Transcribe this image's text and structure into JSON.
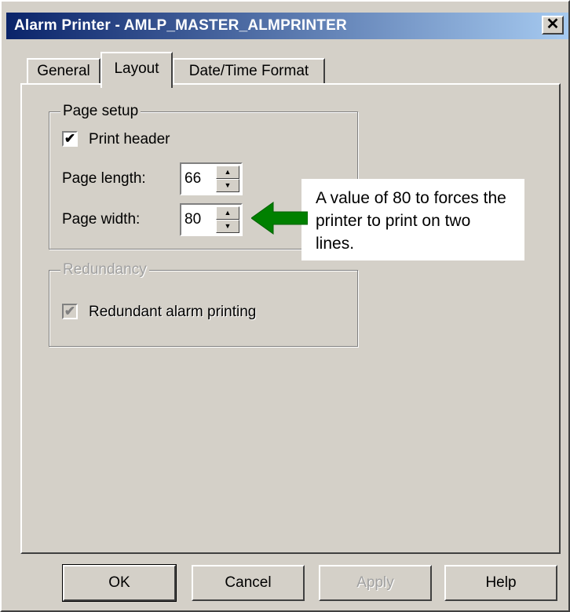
{
  "window": {
    "title": "Alarm Printer - AMLP_MASTER_ALMPRINTER",
    "close_glyph": "✕"
  },
  "tabs": [
    {
      "label": "General",
      "selected": false
    },
    {
      "label": "Layout",
      "selected": true
    },
    {
      "label": "Date/Time Format",
      "selected": false
    }
  ],
  "page_setup": {
    "legend": "Page setup",
    "print_header": {
      "label": "Print header",
      "checked": true
    },
    "page_length": {
      "label": "Page length:",
      "value": "66"
    },
    "page_width": {
      "label": "Page width:",
      "value": "80"
    }
  },
  "redundancy": {
    "legend": "Redundancy",
    "redundant_printing": {
      "label": "Redundant alarm printing",
      "checked": true,
      "disabled": true
    }
  },
  "callout": {
    "text": "A value of 80 to forces the printer to print on two lines.",
    "arrow_color": "#008000"
  },
  "buttons": {
    "ok": "OK",
    "cancel": "Cancel",
    "apply": "Apply",
    "help": "Help"
  },
  "icons": {
    "check": "✔",
    "spin_up": "▲",
    "spin_down": "▼"
  }
}
